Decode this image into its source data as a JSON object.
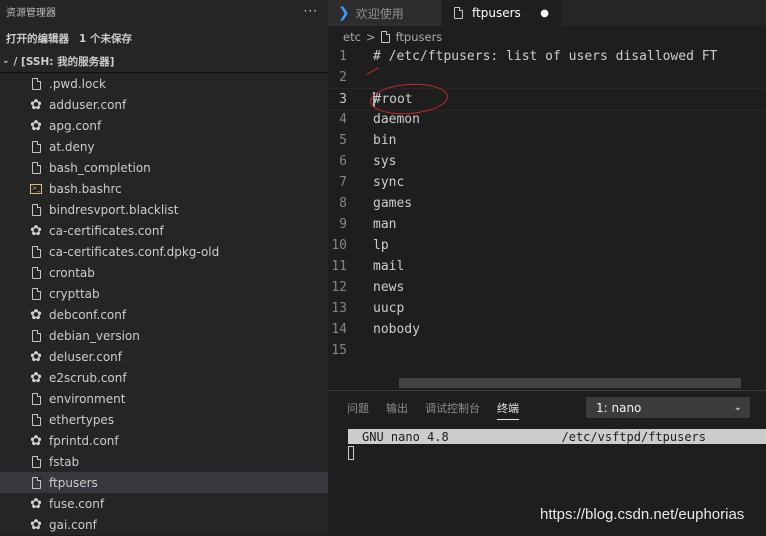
{
  "sidebar": {
    "title": "资源管理器",
    "more": "···",
    "open_editors": {
      "label": "打开的编辑器",
      "count": "1 个未保存"
    },
    "root_label": "/ [SSH: 我的服务器]",
    "files": [
      {
        "label": ".pwd.lock",
        "icon": "file-icon"
      },
      {
        "label": "adduser.conf",
        "icon": "gear-icon"
      },
      {
        "label": "apg.conf",
        "icon": "gear-icon"
      },
      {
        "label": "at.deny",
        "icon": "file-icon"
      },
      {
        "label": "bash_completion",
        "icon": "file-icon"
      },
      {
        "label": "bash.bashrc",
        "icon": "shell-icon"
      },
      {
        "label": "bindresvport.blacklist",
        "icon": "file-icon"
      },
      {
        "label": "ca-certificates.conf",
        "icon": "gear-icon"
      },
      {
        "label": "ca-certificates.conf.dpkg-old",
        "icon": "file-icon"
      },
      {
        "label": "crontab",
        "icon": "file-icon"
      },
      {
        "label": "crypttab",
        "icon": "file-icon"
      },
      {
        "label": "debconf.conf",
        "icon": "gear-icon"
      },
      {
        "label": "debian_version",
        "icon": "file-icon"
      },
      {
        "label": "deluser.conf",
        "icon": "gear-icon"
      },
      {
        "label": "e2scrub.conf",
        "icon": "gear-icon"
      },
      {
        "label": "environment",
        "icon": "file-icon"
      },
      {
        "label": "ethertypes",
        "icon": "file-icon"
      },
      {
        "label": "fprintd.conf",
        "icon": "gear-icon"
      },
      {
        "label": "fstab",
        "icon": "file-icon"
      },
      {
        "label": "ftpusers",
        "icon": "file-icon",
        "selected": true
      },
      {
        "label": "fuse.conf",
        "icon": "gear-icon"
      },
      {
        "label": "gai.conf",
        "icon": "gear-icon"
      }
    ]
  },
  "tabs": [
    {
      "label": "欢迎使用",
      "icon": "vscode-icon"
    },
    {
      "label": "ftpusers",
      "icon": "file-icon",
      "dirty": "●"
    }
  ],
  "breadcrumb": {
    "folder": "etc",
    "separator": ">",
    "file": "ftpusers"
  },
  "editor": {
    "current_line": 3,
    "lines": [
      {
        "num": "1",
        "text": "# /etc/ftpusers: list of users disallowed FT"
      },
      {
        "num": "2",
        "text": ""
      },
      {
        "num": "3",
        "text": "#root"
      },
      {
        "num": "4",
        "text": "daemon"
      },
      {
        "num": "5",
        "text": "bin"
      },
      {
        "num": "6",
        "text": "sys"
      },
      {
        "num": "7",
        "text": "sync"
      },
      {
        "num": "8",
        "text": "games"
      },
      {
        "num": "9",
        "text": "man"
      },
      {
        "num": "10",
        "text": "lp"
      },
      {
        "num": "11",
        "text": "mail"
      },
      {
        "num": "12",
        "text": "news"
      },
      {
        "num": "13",
        "text": "uucp"
      },
      {
        "num": "14",
        "text": "nobody"
      },
      {
        "num": "15",
        "text": ""
      }
    ]
  },
  "panel": {
    "tabs": [
      "问题",
      "输出",
      "调试控制台",
      "终端"
    ],
    "active_tab": "终端",
    "terminal_select": "1: nano",
    "nano_version": "GNU nano 4.8",
    "nano_path": "/etc/vsftpd/ftpusers"
  },
  "watermark": "https://blog.csdn.net/euphorias",
  "colors": {
    "accent": "#3c9cff",
    "annotation": "#c4282d",
    "editor_bg": "#1e1e1e",
    "sidebar_bg": "#252526"
  }
}
